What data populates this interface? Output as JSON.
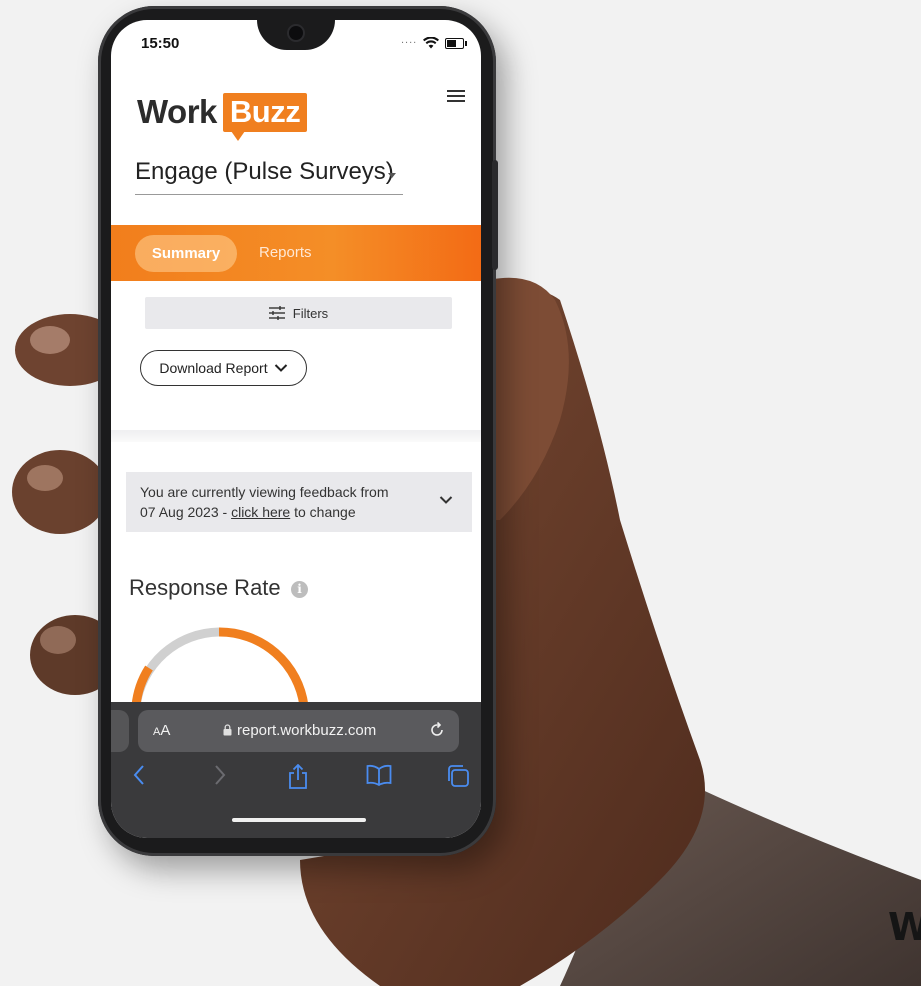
{
  "status_bar": {
    "time": "15:50",
    "signal_dots": "....",
    "wifi_icon": "wifi-icon",
    "battery_icon": "battery-icon"
  },
  "logo": {
    "part1": "Work",
    "part2": "Buzz"
  },
  "survey_select": {
    "value": "Engage (Pulse Surveys)"
  },
  "tabs": [
    {
      "label": "Summary",
      "active": true
    },
    {
      "label": "Reports",
      "active": false
    }
  ],
  "filters": {
    "label": "Filters",
    "icon": "sliders-icon"
  },
  "download": {
    "label": "Download Report",
    "icon": "chevron-down-icon"
  },
  "banner": {
    "line1": "You are currently viewing feedback from",
    "line2_prefix": "07 Aug 2023 - ",
    "link": "click here",
    "line2_suffix": " to change"
  },
  "response_rate": {
    "title": "Response Rate",
    "info_glyph": "i"
  },
  "browser": {
    "text_size": "AA",
    "url": "report.workbuzz.com"
  },
  "watermark": "W",
  "colors": {
    "brand_orange": "#f07f1f",
    "gauge_track": "#d0d0d0",
    "browser_bar": "#3a3a3c"
  }
}
